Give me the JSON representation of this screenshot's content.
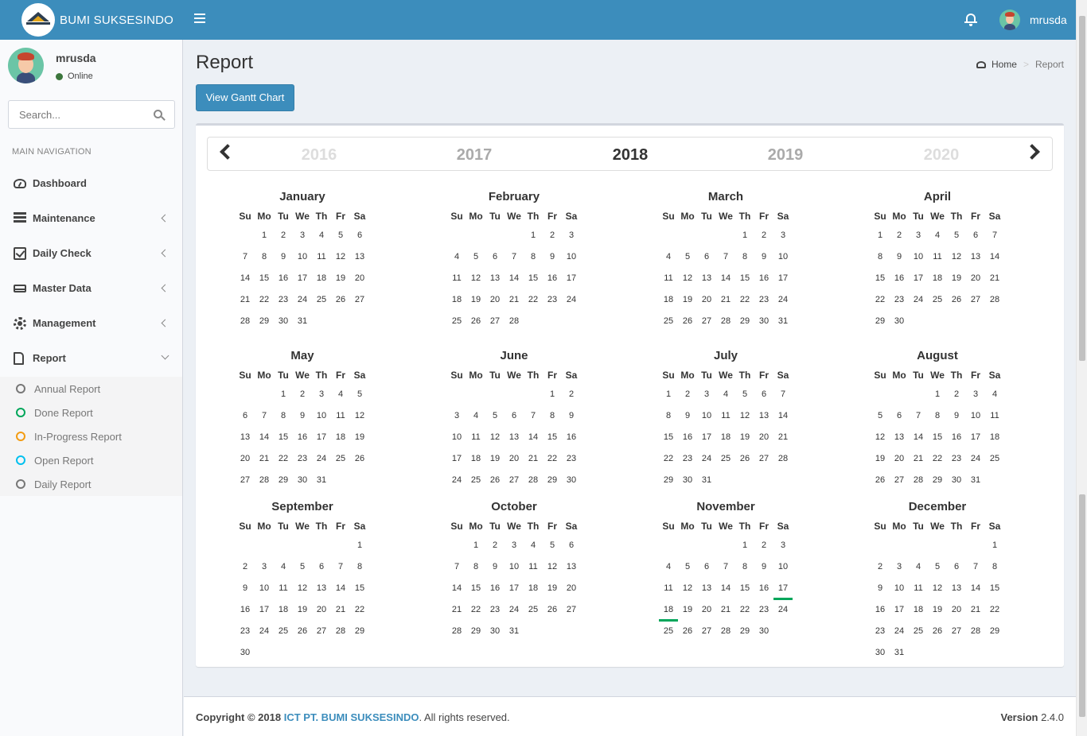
{
  "header": {
    "brand": "BUMI SUKSESINDO",
    "user_name": "mrusda"
  },
  "sidebar": {
    "user_name": "mrusda",
    "status": "Online",
    "search_placeholder": "Search...",
    "nav_header": "MAIN NAVIGATION",
    "items": [
      {
        "label": "Dashboard",
        "icon": "dashboard-icon"
      },
      {
        "label": "Maintenance",
        "icon": "server-icon"
      },
      {
        "label": "Daily Check",
        "icon": "check-square-icon"
      },
      {
        "label": "Master Data",
        "icon": "hdd-icon"
      },
      {
        "label": "Management",
        "icon": "gear-icon"
      },
      {
        "label": "Report",
        "icon": "file-icon"
      }
    ],
    "report_sub": [
      {
        "label": "Annual Report",
        "color": "#777777"
      },
      {
        "label": "Done Report",
        "color": "#00a65a"
      },
      {
        "label": "In-Progress Report",
        "color": "#f39c12"
      },
      {
        "label": "Open Report",
        "color": "#00c0ef"
      },
      {
        "label": "Daily Report",
        "color": "#777777"
      }
    ]
  },
  "main": {
    "title": "Report",
    "breadcrumb": {
      "home": "Home",
      "current": "Report"
    },
    "gantt_button": "View Gantt Chart"
  },
  "calendar": {
    "years": [
      "2016",
      "2017",
      "2018",
      "2019",
      "2020"
    ],
    "selected_year": "2018",
    "weekdays": [
      "Su",
      "Mo",
      "Tu",
      "We",
      "Th",
      "Fr",
      "Sa"
    ],
    "months": [
      {
        "name": "January",
        "start": 1,
        "days": 31
      },
      {
        "name": "February",
        "start": 4,
        "days": 28
      },
      {
        "name": "March",
        "start": 4,
        "days": 31
      },
      {
        "name": "April",
        "start": 0,
        "days": 30
      },
      {
        "name": "May",
        "start": 2,
        "days": 31
      },
      {
        "name": "June",
        "start": 5,
        "days": 30
      },
      {
        "name": "July",
        "start": 0,
        "days": 31
      },
      {
        "name": "August",
        "start": 3,
        "days": 31
      },
      {
        "name": "September",
        "start": 6,
        "days": 30
      },
      {
        "name": "October",
        "start": 1,
        "days": 31
      },
      {
        "name": "November",
        "start": 4,
        "days": 30,
        "marked": [
          17,
          18
        ]
      },
      {
        "name": "December",
        "start": 6,
        "days": 31
      }
    ],
    "marker_color": "#00a65a"
  },
  "footer": {
    "copyright_prefix": "Copyright © 2018",
    "org": "ICT PT. BUMI SUKSESINDO",
    "rights": ". All rights reserved.",
    "version_label": "Version",
    "version": "2.4.0"
  }
}
